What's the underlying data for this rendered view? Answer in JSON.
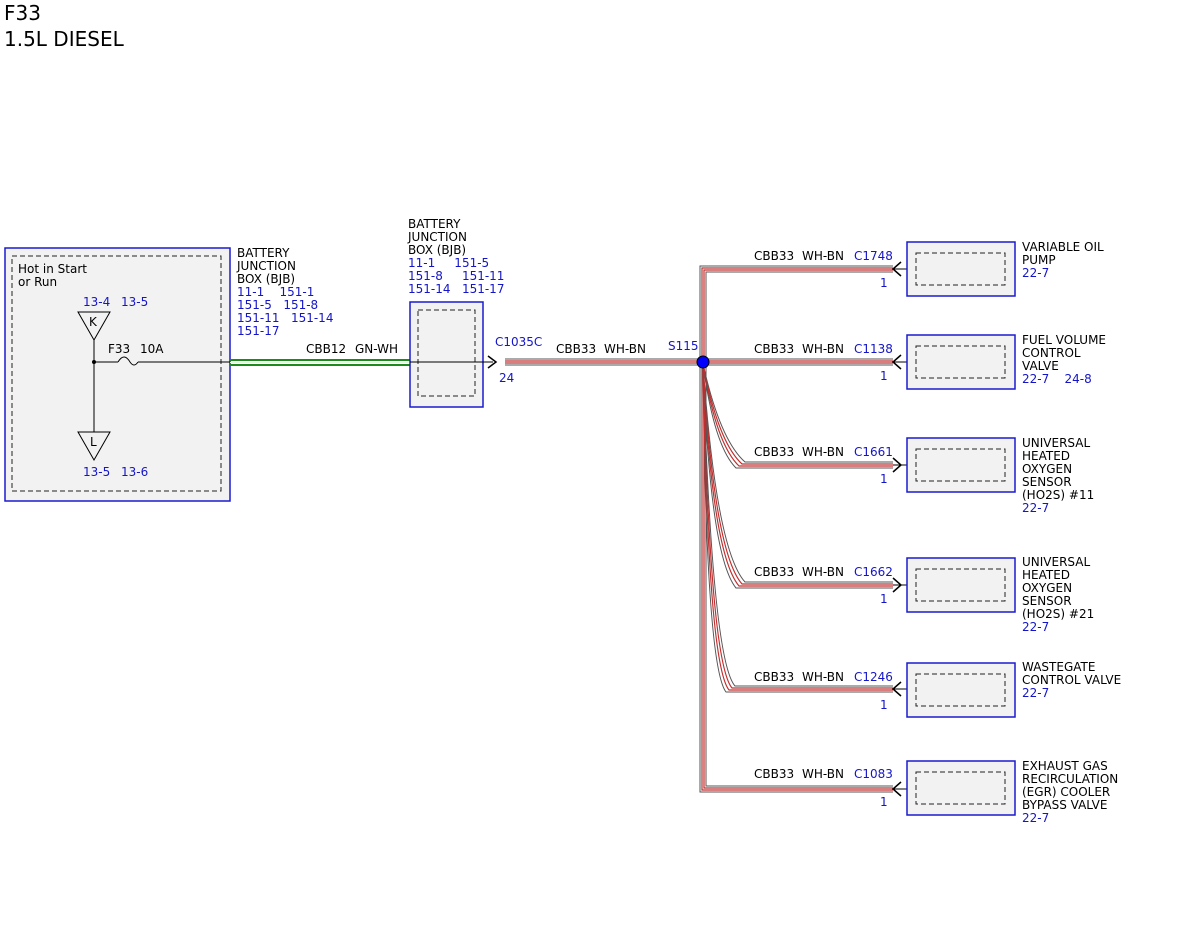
{
  "header": {
    "fuse_id": "F33",
    "engine": "1.5L DIESEL"
  },
  "left_box": {
    "condition": [
      "Hot in Start",
      "or Run"
    ],
    "top_refs": [
      "13-4",
      "13-5"
    ],
    "top_terminal": "K",
    "fuse_label": "F33",
    "fuse_rating": "10A",
    "bottom_terminal": "L",
    "bottom_refs": [
      "13-5",
      "13-6"
    ]
  },
  "bjb_label_1": {
    "name": [
      "BATTERY",
      "JUNCTION",
      "BOX (BJB)"
    ],
    "refs": [
      "11-1    151-1",
      "151-5   151-8",
      "151-11   151-14",
      "151-17"
    ]
  },
  "wire_1": {
    "circuit": "CBB12",
    "color": "GN-WH"
  },
  "bjb_label_2": {
    "name": [
      "BATTERY",
      "JUNCTION",
      "BOX (BJB)"
    ],
    "refs": [
      "11-1     151-5",
      "151-8     151-11",
      "151-14   151-17"
    ]
  },
  "connector_main": {
    "id": "C1035C",
    "pin": "24"
  },
  "wire_2": {
    "circuit": "CBB33",
    "color": "WH-BN"
  },
  "splice": {
    "id": "S115"
  },
  "branches": [
    {
      "circuit": "CBB33",
      "color": "WH-BN",
      "connector": "C1748",
      "pin": "1",
      "name": [
        "VARIABLE OIL",
        "PUMP"
      ],
      "refs": "22-7"
    },
    {
      "circuit": "CBB33",
      "color": "WH-BN",
      "connector": "C1138",
      "pin": "1",
      "name": [
        "FUEL VOLUME",
        "CONTROL",
        "VALVE"
      ],
      "refs": "22-7    24-8"
    },
    {
      "circuit": "CBB33",
      "color": "WH-BN",
      "connector": "C1661",
      "pin": "1",
      "name": [
        "UNIVERSAL",
        "HEATED",
        "OXYGEN",
        "SENSOR",
        "(HO2S) #11"
      ],
      "refs": "22-7"
    },
    {
      "circuit": "CBB33",
      "color": "WH-BN",
      "connector": "C1662",
      "pin": "1",
      "name": [
        "UNIVERSAL",
        "HEATED",
        "OXYGEN",
        "SENSOR",
        "(HO2S) #21"
      ],
      "refs": "22-7"
    },
    {
      "circuit": "CBB33",
      "color": "WH-BN",
      "connector": "C1246",
      "pin": "1",
      "name": [
        "WASTEGATE",
        "CONTROL VALVE"
      ],
      "refs": "22-7"
    },
    {
      "circuit": "CBB33",
      "color": "WH-BN",
      "connector": "C1083",
      "pin": "1",
      "name": [
        "EXHAUST GAS",
        "RECIRCULATION",
        "(EGR) COOLER",
        "BYPASS VALVE"
      ],
      "refs": "22-7"
    }
  ],
  "colors": {
    "component_border": "#1a1acf",
    "reference_text": "#1515c8",
    "wire_green": "#1e8a1e",
    "wire_red": "#c03030",
    "splice_dot": "#0000ff"
  }
}
